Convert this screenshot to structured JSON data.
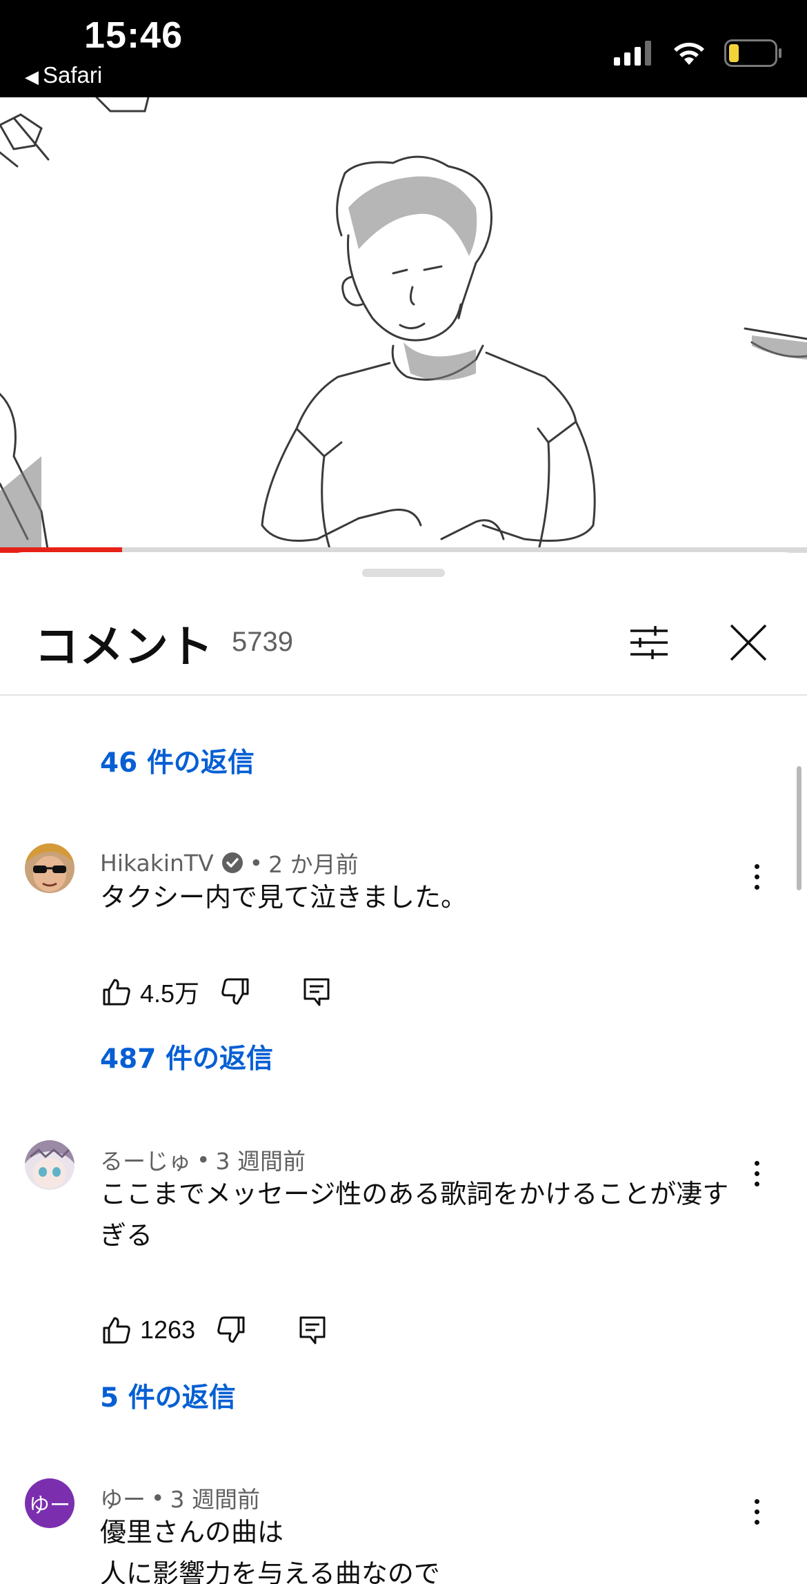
{
  "status_bar": {
    "time": "15:46",
    "back_app": "Safari"
  },
  "comments_panel": {
    "title": "コメント",
    "count": "5739"
  },
  "replies_top": "46 件の返信",
  "comments": [
    {
      "author": "HikakinTV",
      "verified": true,
      "separator": "•",
      "time": "2 か月前",
      "text": "タクシー内で見て泣きました。",
      "likes": "4.5万",
      "replies": "487 件の返信"
    },
    {
      "author": "るーじゅ",
      "separator": "•",
      "time": "3 週間前",
      "text": "ここまでメッセージ性のある歌詞をかけることが凄すぎる",
      "likes": "1263",
      "replies": "5 件の返信"
    },
    {
      "author": "ゆー",
      "avatar_letter": "ゆー",
      "separator": "•",
      "time": "3 週間前",
      "text_line1": "優里さんの曲は",
      "text_line2": "人に影響力を与える曲なので"
    }
  ],
  "colors": {
    "link": "#065fd4",
    "progress": "#e62117",
    "avatar_purple": "#7b2fae"
  }
}
